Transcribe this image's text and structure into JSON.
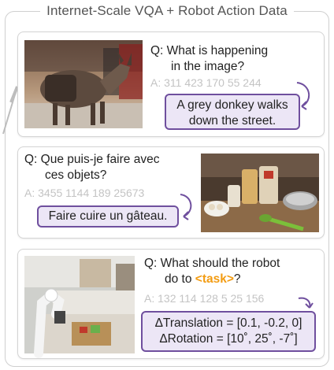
{
  "title": "Internet-Scale VQA + Robot Action Data",
  "examples": [
    {
      "question_line1": "Q: What is happening",
      "question_line2": "in the image?",
      "tokens": "A: 311 423 170 55 244",
      "answer_line1": "A grey donkey walks",
      "answer_line2": "down the street.",
      "image": "donkey-photo"
    },
    {
      "question_line1": "Q: Que puis-je faire avec",
      "question_line2": "ces objets?",
      "tokens": "A: 3455 1144 189 25673",
      "answer_line1": "Faire cuire un gâteau.",
      "image": "baking-ingredients-photo"
    },
    {
      "question_line1": "Q: What should the robot",
      "question_line2_prefix": "do to ",
      "question_line2_task": "<task>",
      "question_line2_suffix": "?",
      "tokens": "A: 132 114 128 5 25 156",
      "answer_line1": "ΔTranslation = [0.1, -0.2, 0]",
      "answer_line2": "ΔRotation = [10˚, 25˚, -7˚]",
      "image": "robot-arm-photo"
    }
  ],
  "colors": {
    "answer_border": "#6f4f9e",
    "answer_fill": "#ece6f6",
    "task_highlight": "#f39c12",
    "token_gray": "#c4c4c4"
  }
}
